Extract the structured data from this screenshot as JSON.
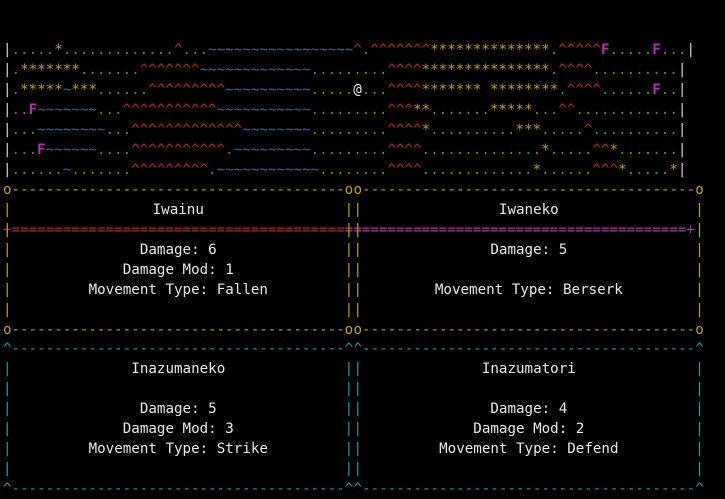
{
  "map": {
    "rows": [
      "|.....*.............^...~~~~~~~~~~~~~~~~~^.^^^^^^^**************.^^^^^F.....F...|",
      "|.*******.......^^^^^^^~~~~~~~~~~~~~.........^^^^***************.^^^^..........|",
      "|.*****~***......^^^^^^^^^~~~~~~~~~~.....@...^^^^******* ********.^^^^......F..|",
      "|..F~~~~~~~...^^^^^^^^^^^~~~~~~~~~~~.........^^^**.......*****...^^............|",
      "|...~~~~~~~~...^^^^^^^^^^^^^~~~~~~~~.........^^^^*..........***.....^..........|",
      "|...F~~~~~~....^^^^^^^^^^^.~~~~~~~~~.........^^^^..............*.....^^*.......|",
      "|......~.......^^^^^^^^^.~~~~~~~~~~~~........^^^^.............*......^^^*.....*|"
    ],
    "separator_left": "+=======================================",
    "separator_right": "========================================+"
  },
  "cards": [
    {
      "name": "Iwainu",
      "lines": [
        "Damage: 6",
        "Damage Mod: 1",
        "Movement Type: Fallen"
      ],
      "corner": "o",
      "color": "#c4a000"
    },
    {
      "name": "Iwaneko",
      "lines": [
        "Damage: 5",
        "",
        "Movement Type: Berserk"
      ],
      "corner": "o",
      "color": "#c4a000"
    },
    {
      "name": "Inazumaneko",
      "lines": [
        "Damage: 5",
        "Damage Mod: 3",
        "Movement Type: Strike"
      ],
      "corner": "^",
      "color": "#16a0b0"
    },
    {
      "name": "Inazumatori",
      "lines": [
        "Damage: 4",
        "Damage Mod: 2",
        "Movement Type: Defend"
      ],
      "corner": "^",
      "color": "#16a0b0"
    }
  ]
}
